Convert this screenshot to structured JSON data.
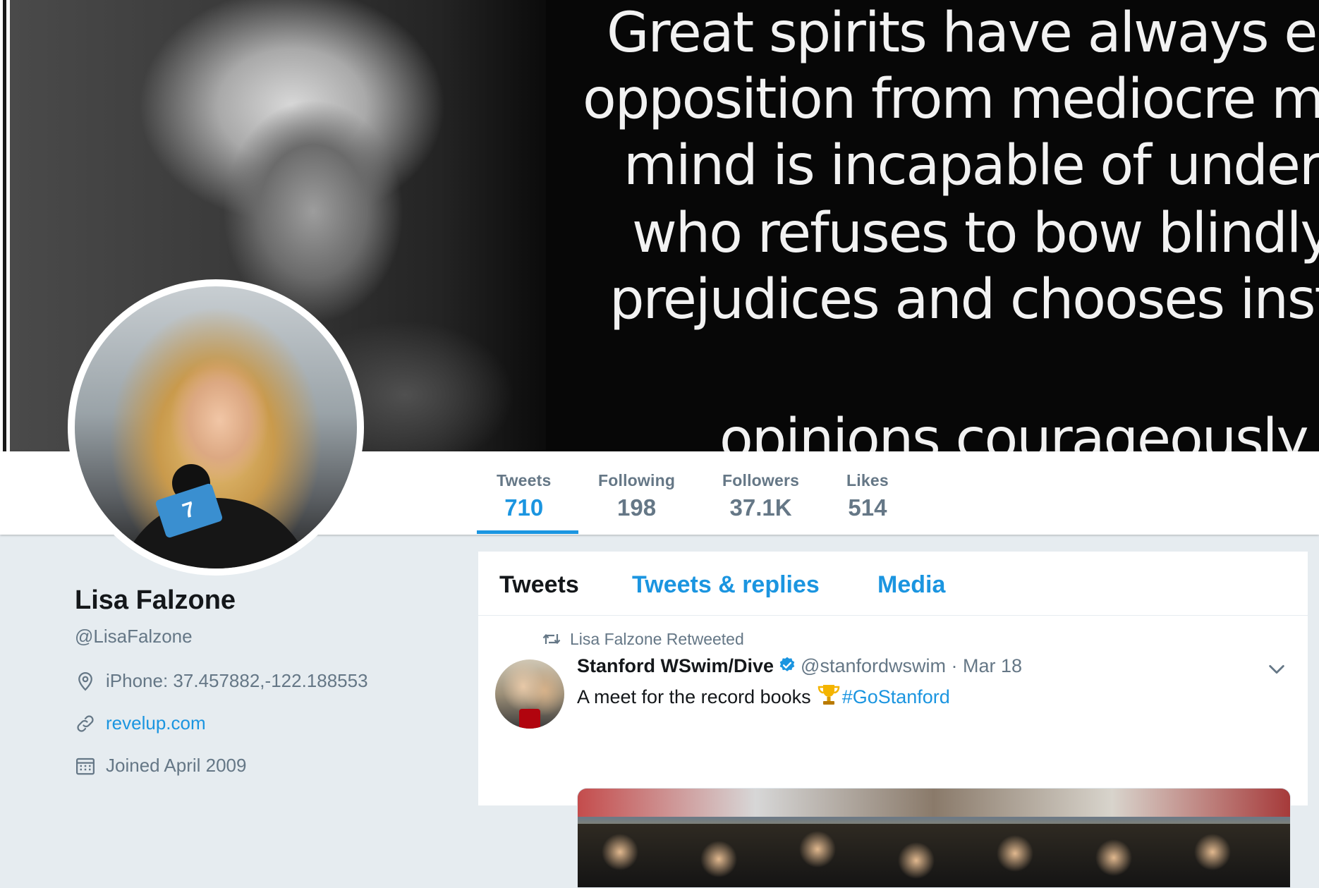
{
  "banner": {
    "quote_lines": [
      "Great spirits have always enc",
      "opposition from mediocre min",
      "mind is incapable of underst",
      "who refuses to bow blindly",
      "prejudices and chooses instea",
      "opinions courageously ar"
    ]
  },
  "stats": [
    {
      "label": "Tweets",
      "value": "710"
    },
    {
      "label": "Following",
      "value": "198"
    },
    {
      "label": "Followers",
      "value": "37.1K"
    },
    {
      "label": "Likes",
      "value": "514"
    }
  ],
  "profile": {
    "name": "Lisa Falzone",
    "handle": "@LisaFalzone",
    "location": "iPhone: 37.457882,-122.188553",
    "website": "revelup.com",
    "joined": "Joined April 2009",
    "avatar_badge": "7"
  },
  "tabs": [
    {
      "label": "Tweets"
    },
    {
      "label": "Tweets & replies"
    },
    {
      "label": "Media"
    }
  ],
  "tweet": {
    "retweet_context": "Lisa Falzone Retweeted",
    "display_name": "Stanford WSwim/Dive",
    "user_handle": "@stanfordwswim",
    "separator": "·",
    "time": "Mar 18",
    "text": "A meet for the record books",
    "hashtag": "#GoStanford"
  },
  "colors": {
    "accent": "#1b95e0",
    "secondary_text": "#657786",
    "background": "#e6ecf0"
  },
  "icons": {
    "location": "location-pin-icon",
    "link": "link-icon",
    "calendar": "calendar-icon",
    "retweet": "retweet-icon",
    "verified": "verified-badge-icon",
    "caret": "chevron-down-icon",
    "trophy": "trophy-icon"
  }
}
